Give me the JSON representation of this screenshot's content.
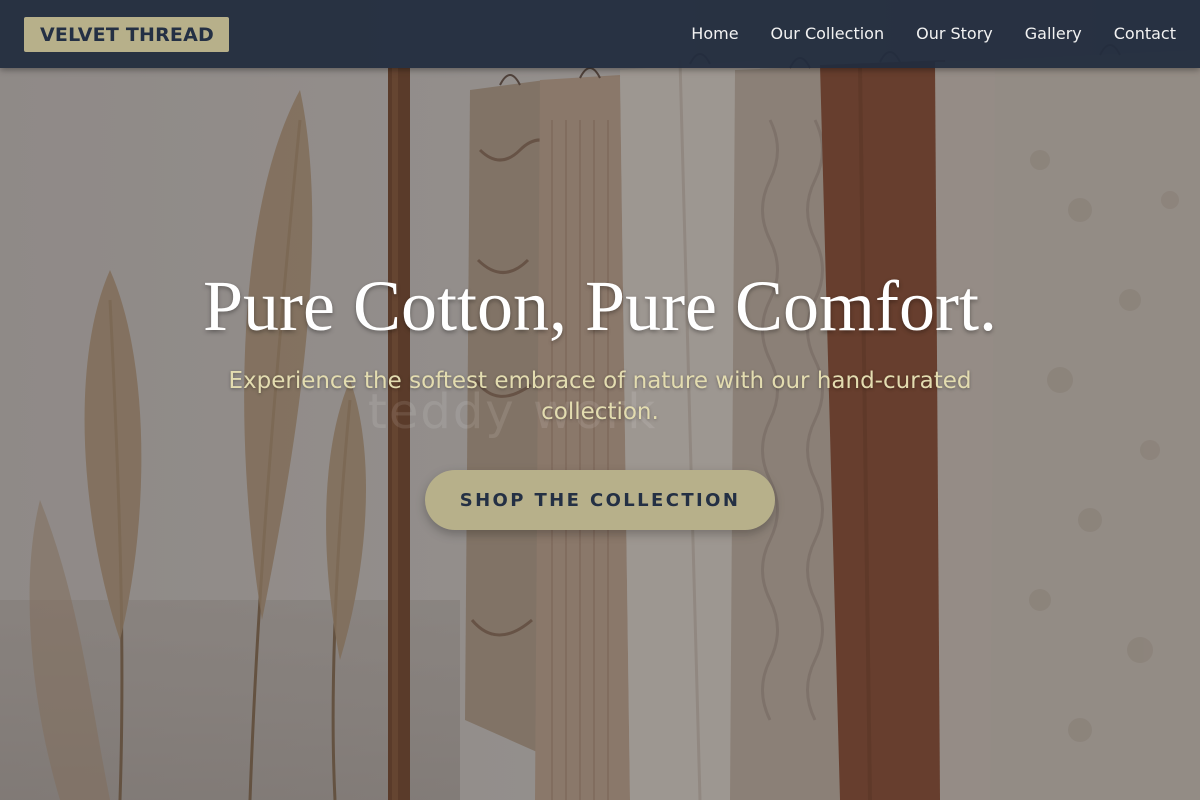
{
  "brand": {
    "name": "VELVET THREAD"
  },
  "nav": {
    "links": [
      {
        "label": "Home"
      },
      {
        "label": "Our Collection"
      },
      {
        "label": "Our Story"
      },
      {
        "label": "Gallery"
      },
      {
        "label": "Contact"
      }
    ]
  },
  "hero": {
    "title": "Pure Cotton, Pure Comfort.",
    "subtitle": "Experience the softest embrace of nature with our hand-curated collection.",
    "cta_label": "SHOP THE COLLECTION",
    "watermark": "teddy  work"
  },
  "colors": {
    "nav_background": "#232d3f",
    "accent_gold": "#b7b08a",
    "brand_text": "#243044",
    "subtitle_text": "#e3dcb0"
  }
}
